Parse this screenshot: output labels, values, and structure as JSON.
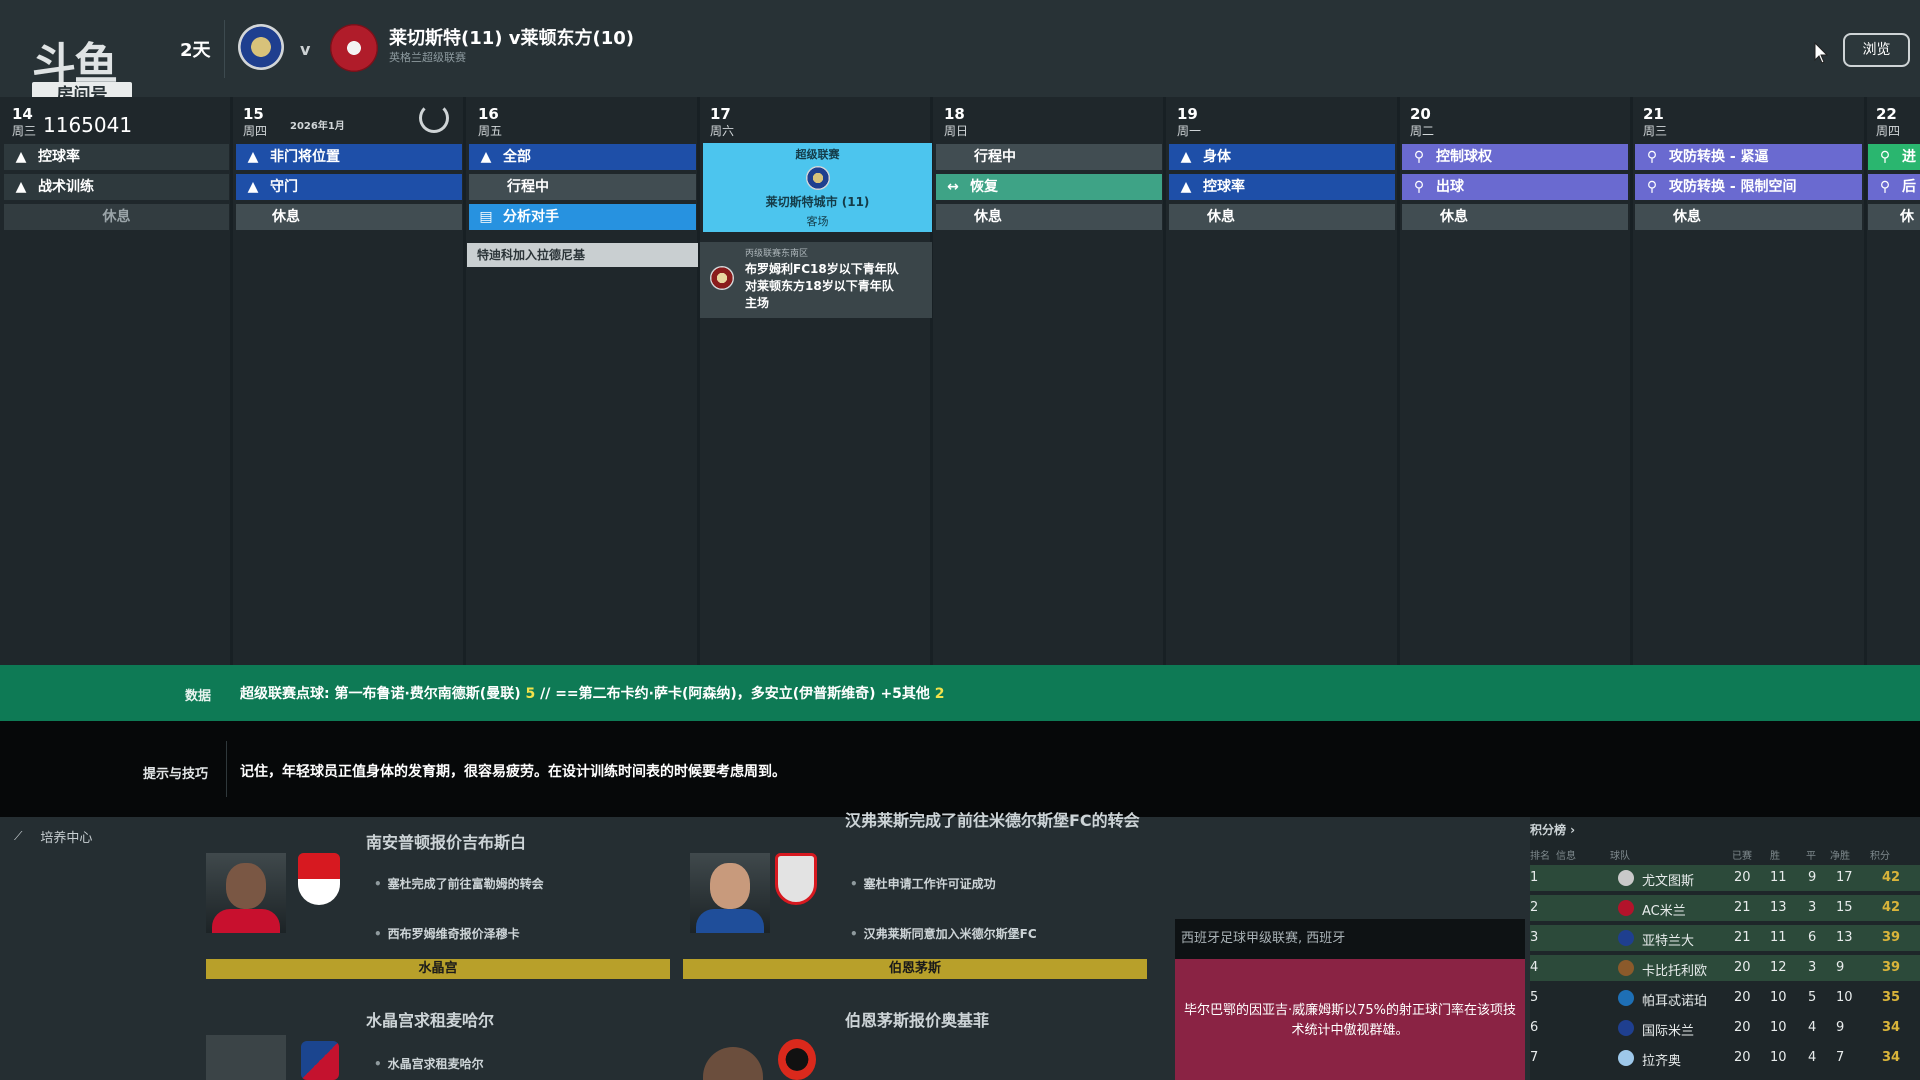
{
  "header": {
    "logo_brand": "斗鱼",
    "logo_room": "房间号",
    "days": "2天",
    "vs": "v",
    "match_title": "莱切斯特(11) v莱顿东方(10)",
    "match_sub": "英格兰超级联赛",
    "browse_label": "浏览"
  },
  "calendar": {
    "room_id": "1165041",
    "month_label": "2026年1月",
    "days": [
      {
        "num": "14",
        "wd": "周三"
      },
      {
        "num": "15",
        "wd": "周四"
      },
      {
        "num": "16",
        "wd": "周五"
      },
      {
        "num": "17",
        "wd": "周六"
      },
      {
        "num": "18",
        "wd": "周日"
      },
      {
        "num": "19",
        "wd": "周一"
      },
      {
        "num": "20",
        "wd": "周二"
      },
      {
        "num": "21",
        "wd": "周三"
      },
      {
        "num": "22",
        "wd": "周四"
      }
    ],
    "slots": {
      "d14": [
        "控球率",
        "战术训练",
        "休息"
      ],
      "d15": [
        "非门将位置",
        "守门",
        "休息"
      ],
      "d16": [
        "全部",
        "行程中",
        "分析对手"
      ],
      "d18": [
        "行程中",
        "恢复",
        "休息"
      ],
      "d19": [
        "身体",
        "控球率",
        "休息"
      ],
      "d20": [
        "控制球权",
        "出球",
        "休息"
      ],
      "d21": [
        "攻防转换 - 紧逼",
        "攻防转换 - 限制空间",
        "休息"
      ],
      "d22": [
        "进",
        "后",
        "休"
      ]
    },
    "match_card": {
      "league": "超级联赛",
      "team": "莱切斯特城市 (11)",
      "venue": "客场"
    },
    "event_note": "特迪科加入拉德尼基",
    "youth_card": {
      "league": "丙级联赛东南区",
      "line1": "布罗姆利FC18岁以下青年队",
      "line2": "对莱顿东方18岁以下青年队",
      "line3": "主场"
    }
  },
  "data_strip": {
    "label": "数据",
    "text_a": "超级联赛点球: 第一布鲁诺·费尔南德斯(曼联) ",
    "num_a": "5",
    "text_b": " // ==第二布卡约·萨卡(阿森纳)，多安立(伊普斯维奇) +5其他 ",
    "num_b": "2"
  },
  "tips_strip": {
    "label": "提示与技巧",
    "text": "记住，年轻球员正值身体的发育期，很容易疲劳。在设计训练时间表的时候要考虑周到。"
  },
  "bottom": {
    "hub_label": "培养中心",
    "news1": {
      "headline": "南安普顿报价吉布斯白",
      "bullet1": "塞杜完成了前往富勒姆的转会",
      "bullet2": "西布罗姆维奇报价泽穆卡",
      "strip": "水晶宫"
    },
    "news2": {
      "headline": "汉弗莱斯完成了前往米德尔斯堡FC的转会",
      "bullet1": "塞杜申请工作许可证成功",
      "bullet2": "汉弗莱斯同意加入米德尔斯堡FC",
      "strip": "伯恩茅斯"
    },
    "news3": {
      "headline": "水晶宫求租麦哈尔",
      "bullet": "水晶宫求租麦哈尔"
    },
    "news4": {
      "headline": "伯恩茅斯报价奥基菲"
    },
    "league_box": {
      "header": "西班牙足球甲级联赛, 西班牙",
      "message": "毕尔巴鄂的因亚吉·威廉姆斯以75%的射正球门率在该项技术统计中傲视群雄。"
    },
    "table": {
      "title": "积分榜 ›",
      "columns": [
        "排名",
        "信息",
        "球队",
        "已赛",
        "胜",
        "平",
        "净胜",
        "积分"
      ],
      "rows": [
        {
          "pos": "1",
          "team": "尤文图斯",
          "p": "20",
          "w": "11",
          "d": "9",
          "gd": "17",
          "pts": "42"
        },
        {
          "pos": "2",
          "team": "AC米兰",
          "p": "21",
          "w": "13",
          "d": "3",
          "gd": "15",
          "pts": "42"
        },
        {
          "pos": "3",
          "team": "亚特兰大",
          "p": "21",
          "w": "11",
          "d": "6",
          "gd": "13",
          "pts": "39"
        },
        {
          "pos": "4",
          "team": "卡比托利欧",
          "p": "20",
          "w": "12",
          "d": "3",
          "gd": "9",
          "pts": "39"
        },
        {
          "pos": "5",
          "team": "帕耳忒诺珀",
          "p": "20",
          "w": "10",
          "d": "5",
          "gd": "10",
          "pts": "35"
        },
        {
          "pos": "6",
          "team": "国际米兰",
          "p": "20",
          "w": "10",
          "d": "4",
          "gd": "9",
          "pts": "34"
        },
        {
          "pos": "7",
          "team": "拉齐奥",
          "p": "20",
          "w": "10",
          "d": "4",
          "gd": "7",
          "pts": "34"
        }
      ]
    }
  },
  "colors": {
    "slot_blue": "#1e4fa8",
    "slot_purple": "#6a6ad0",
    "match_card": "#4cc5ee",
    "data_strip": "#0e7a55",
    "league_box": "#8a2344",
    "strip_gold": "#b8a02a"
  }
}
